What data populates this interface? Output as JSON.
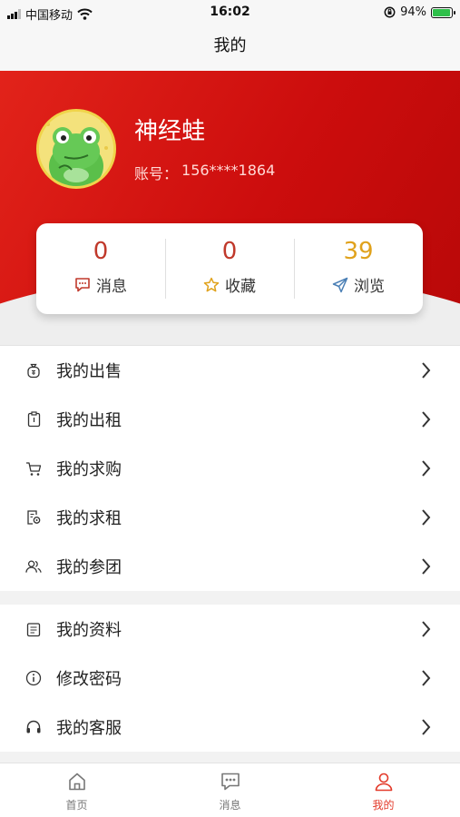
{
  "status_bar": {
    "carrier": "中国移动",
    "time": "16:02",
    "battery": "94%",
    "battery_level": 0.94,
    "icons": [
      "signal-icon",
      "wifi-icon",
      "orientation-lock-icon",
      "battery-icon"
    ]
  },
  "navbar": {
    "title": "我的"
  },
  "profile": {
    "name": "神经蛙",
    "account_label": "账号：",
    "account_value": "156****1864",
    "avatar_icon": "frog-avatar-icon"
  },
  "stats": [
    {
      "value": "0",
      "label": "消息",
      "icon": "message-icon",
      "color": "#c0392b"
    },
    {
      "value": "0",
      "label": "收藏",
      "icon": "star-icon",
      "color": "#c0392b"
    },
    {
      "value": "39",
      "label": "浏览",
      "icon": "send-icon",
      "color": "#e0a21c"
    }
  ],
  "menu_group_1": [
    {
      "label": "我的出售",
      "icon": "money-bag-icon"
    },
    {
      "label": "我的出租",
      "icon": "clipboard-icon"
    },
    {
      "label": "我的求购",
      "icon": "cart-icon"
    },
    {
      "label": "我的求租",
      "icon": "document-search-icon"
    },
    {
      "label": "我的参团",
      "icon": "group-icon"
    }
  ],
  "menu_group_2": [
    {
      "label": "我的资料",
      "icon": "profile-doc-icon"
    },
    {
      "label": "修改密码",
      "icon": "info-icon"
    },
    {
      "label": "我的客服",
      "icon": "headset-icon"
    }
  ],
  "tabbar": [
    {
      "label": "首页",
      "icon": "home-icon",
      "active": false
    },
    {
      "label": "消息",
      "icon": "chat-bubble-icon",
      "active": false
    },
    {
      "label": "我的",
      "icon": "user-icon",
      "active": true
    }
  ],
  "colors": {
    "brand_red": "#d8140f",
    "active_tab": "#e33a2a",
    "stat_red": "#c0392b",
    "stat_gold": "#e0a21c"
  }
}
